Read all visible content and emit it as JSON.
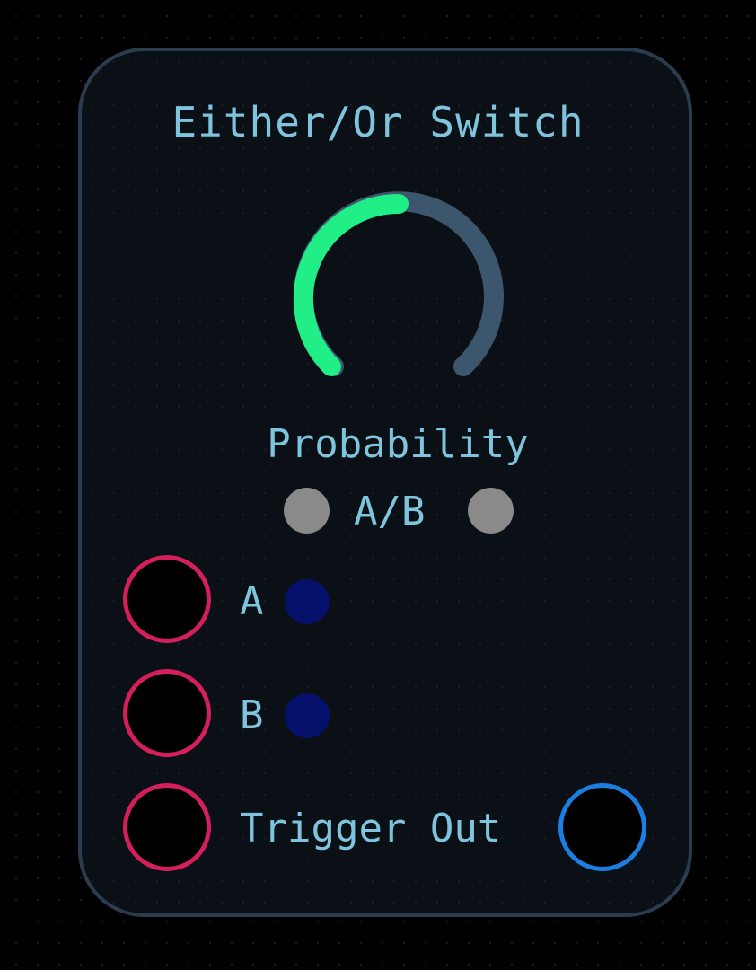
{
  "module": {
    "title": "Either/Or Switch"
  },
  "knob": {
    "label": "Probability",
    "value": 0.5,
    "active_color": "#22ee88",
    "track_color": "#3b566d"
  },
  "indicator": {
    "label": "A/B",
    "led_color": "#8a8a8a"
  },
  "inputs": [
    {
      "label": "A",
      "led_color": "#05106a",
      "jack_color": "#d41f5c"
    },
    {
      "label": "B",
      "led_color": "#05106a",
      "jack_color": "#d41f5c"
    }
  ],
  "trigger": {
    "label": "Trigger Out",
    "input_jack_color": "#d41f5c",
    "output_jack_color": "#1a7fe0"
  },
  "icons": {
    "knob": "probability-knob-icon",
    "led": "led-indicator-icon",
    "jack": "patch-jack-icon"
  }
}
